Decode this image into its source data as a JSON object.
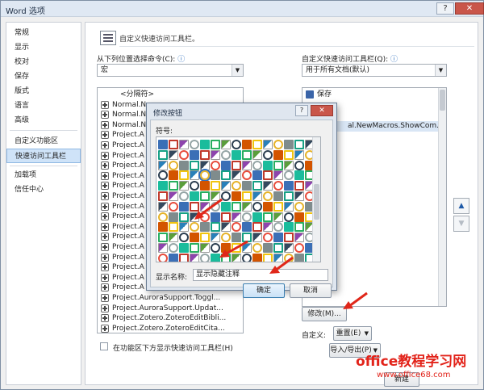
{
  "window": {
    "title": "Word 选项",
    "help_btn": "?",
    "close_btn": "✕"
  },
  "nav": {
    "items": [
      "常规",
      "显示",
      "校对",
      "保存",
      "版式",
      "语言",
      "高级",
      "自定义功能区",
      "快速访问工具栏",
      "加载项",
      "信任中心"
    ],
    "active": "快速访问工具栏"
  },
  "content": {
    "header": "自定义快速访问工具栏。",
    "choose_label": "从下列位置选择命令(C):",
    "choose_info": "ⓘ",
    "choose_value": "宏",
    "customize_label": "自定义快速访问工具栏(Q):",
    "customize_info": "ⓘ",
    "customize_value": "用于所有文档(默认)",
    "left_list": [
      "<分隔符>",
      "Normal.N",
      "Normal.N",
      "Normal.N",
      "Project.A",
      "Project.A",
      "Project.A",
      "Project.A",
      "Project.A",
      "Project.A",
      "Project.A",
      "Project.A",
      "Project.A",
      "Project.A",
      "Project.A",
      "Project.A",
      "Project.A",
      "Project.A",
      "Project.A",
      "Project.A",
      "Project.AuroraSupport.Toggl...",
      "Project.AuroraSupport.Updat...",
      "Project.Zotero.ZoteroEditBibli...",
      "Project.Zotero.ZoteroEditCita..."
    ],
    "right_list": [
      {
        "label": "保存",
        "selected": false
      },
      {
        "label": "",
        "selected": false
      },
      {
        "label": "",
        "selected": false
      },
      {
        "label": "al.NewMacros.ShowCom...",
        "selected": true
      }
    ],
    "modify_btn": "修改(M)...",
    "customize_row_label": "自定义:",
    "reset_btn": "重置(E)",
    "import_export_btn": "导入/导出(P)",
    "checkbox_label": "在功能区下方显示快速访问工具栏(H)",
    "new_btn_fragment": "新建"
  },
  "dialog": {
    "title": "修改按钮",
    "help_btn": "?",
    "close_btn": "✕",
    "symbol_label": "符号:",
    "display_name_label": "显示名称:",
    "display_name_value": "显示隐藏注释",
    "ok_btn": "确定",
    "cancel_btn": "取消"
  },
  "watermark": {
    "main": "office教程学习网",
    "url": "www.office68.com"
  },
  "colors": {
    "accent": "#2f6fbf",
    "red_arrow": "#e0271a",
    "watermark": "#e2231a"
  }
}
